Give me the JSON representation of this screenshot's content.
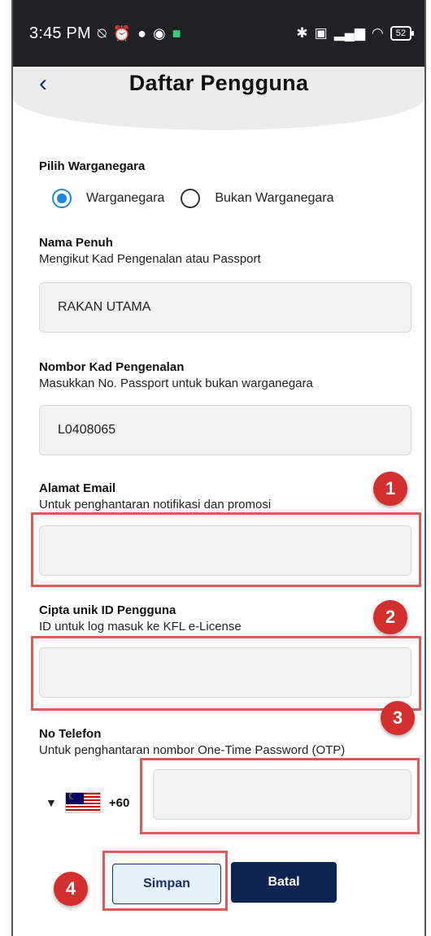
{
  "status_bar": {
    "time": "3:45 PM",
    "battery": "52"
  },
  "header": {
    "back_icon": "chevron-left-icon",
    "title": "Daftar Pengguna"
  },
  "citizenship": {
    "label": "Pilih Warganegara",
    "options": [
      {
        "label": "Warganegara",
        "checked": true
      },
      {
        "label": "Bukan Warganegara",
        "checked": false
      }
    ]
  },
  "fields": {
    "full_name": {
      "label": "Nama Penuh",
      "sub": "Mengikut Kad Pengenalan atau Passport",
      "value": "RAKAN UTAMA"
    },
    "ic_number": {
      "label": "Nombor Kad Pengenalan",
      "sub": "Masukkan No. Passport untuk bukan warganegara",
      "value": "L0408065"
    },
    "email": {
      "label": "Alamat Email",
      "sub": "Untuk penghantaran notifikasi dan promosi",
      "value": ""
    },
    "user_id": {
      "label": "Cipta unik ID Pengguna",
      "sub": "ID untuk log masuk ke KFL e-License",
      "value": ""
    },
    "phone": {
      "label": "No Telefon",
      "sub": "Untuk penghantaran nombor One-Time Password (OTP)",
      "country_code": "+60",
      "value": ""
    }
  },
  "badges": [
    "1",
    "2",
    "3",
    "4"
  ],
  "buttons": {
    "save": "Simpan",
    "cancel": "Batal"
  },
  "colors": {
    "primary": "#0d2452",
    "radio": "#1e88e5",
    "annotation": "#d32f2f"
  }
}
